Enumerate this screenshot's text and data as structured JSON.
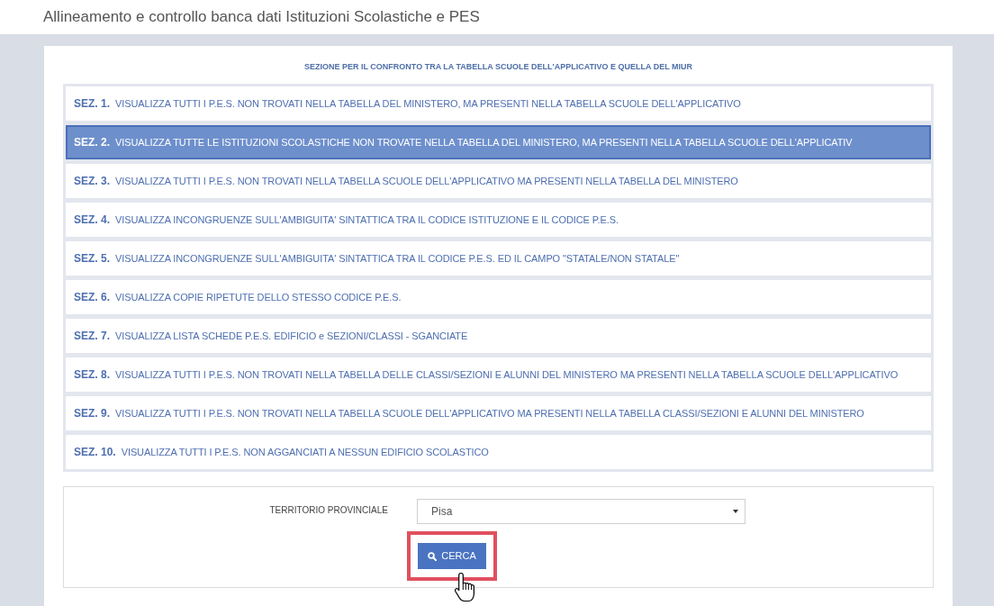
{
  "page_title": "Allineamento e controllo banca dati Istituzioni Scolastiche e PES",
  "panel": {
    "heading": "SEZIONE PER IL CONFRONTO TRA LA TABELLA SCUOLE DELL'APPLICATIVO E QUELLA DEL MIUR",
    "sections": [
      {
        "number": "SEZ. 1.",
        "label": "VISUALIZZA TUTTI I P.E.S. NON TROVATI NELLA TABELLA DEL MINISTERO, MA PRESENTI NELLA TABELLA SCUOLE DELL'APPLICATIVO",
        "selected": false
      },
      {
        "number": "SEZ. 2.",
        "label": "VISUALIZZA TUTTE LE ISTITUZIONI SCOLASTICHE NON TROVATE NELLA TABELLA DEL MINISTERO, MA PRESENTI NELLA TABELLA SCUOLE DELL'APPLICATIV",
        "selected": true
      },
      {
        "number": "SEZ. 3.",
        "label": "VISUALIZZA TUTTI I P.E.S. NON TROVATI NELLA TABELLA SCUOLE DELL'APPLICATIVO MA PRESENTI NELLA TABELLA DEL MINISTERO",
        "selected": false
      },
      {
        "number": "SEZ. 4.",
        "label": "VISUALIZZA INCONGRUENZE SULL'AMBIGUITA' SINTATTICA TRA IL CODICE ISTITUZIONE E IL CODICE P.E.S.",
        "selected": false
      },
      {
        "number": "SEZ. 5.",
        "label": "VISUALIZZA INCONGRUENZE SULL'AMBIGUITA' SINTATTICA TRA IL CODICE P.E.S. ED IL CAMPO \"STATALE/NON STATALE\"",
        "selected": false
      },
      {
        "number": "SEZ. 6.",
        "label": "VISUALIZZA COPIE RIPETUTE DELLO STESSO CODICE P.E.S.",
        "selected": false
      },
      {
        "number": "SEZ. 7.",
        "label": "VISUALIZZA LISTA SCHEDE P.E.S. EDIFICIO e SEZIONI/CLASSI - SGANCIATE",
        "selected": false
      },
      {
        "number": "SEZ. 8.",
        "label": "VISUALIZZA TUTTI I P.E.S. NON TROVATI NELLA TABELLA DELLE CLASSI/SEZIONI E ALUNNI DEL MINISTERO MA PRESENTI NELLA TABELLA SCUOLE DELL'APPLICATIVO",
        "selected": false
      },
      {
        "number": "SEZ. 9.",
        "label": "VISUALIZZA TUTTI I P.E.S. NON TROVATI NELLA TABELLA SCUOLE DELL'APPLICATIVO MA PRESENTI NELLA TABELLA CLASSI/SEZIONI E ALUNNI DEL MINISTERO",
        "selected": false
      },
      {
        "number": "SEZ. 10.",
        "label": "VISUALIZZA TUTTI I P.E.S. NON AGGANCIATI A NESSUN EDIFICIO SCOLASTICO",
        "selected": false
      }
    ],
    "filter": {
      "label": "TERRITORIO PROVINCIALE",
      "value": "Pisa"
    },
    "search_button": {
      "label": "CERCA",
      "highlighted": true
    }
  }
}
